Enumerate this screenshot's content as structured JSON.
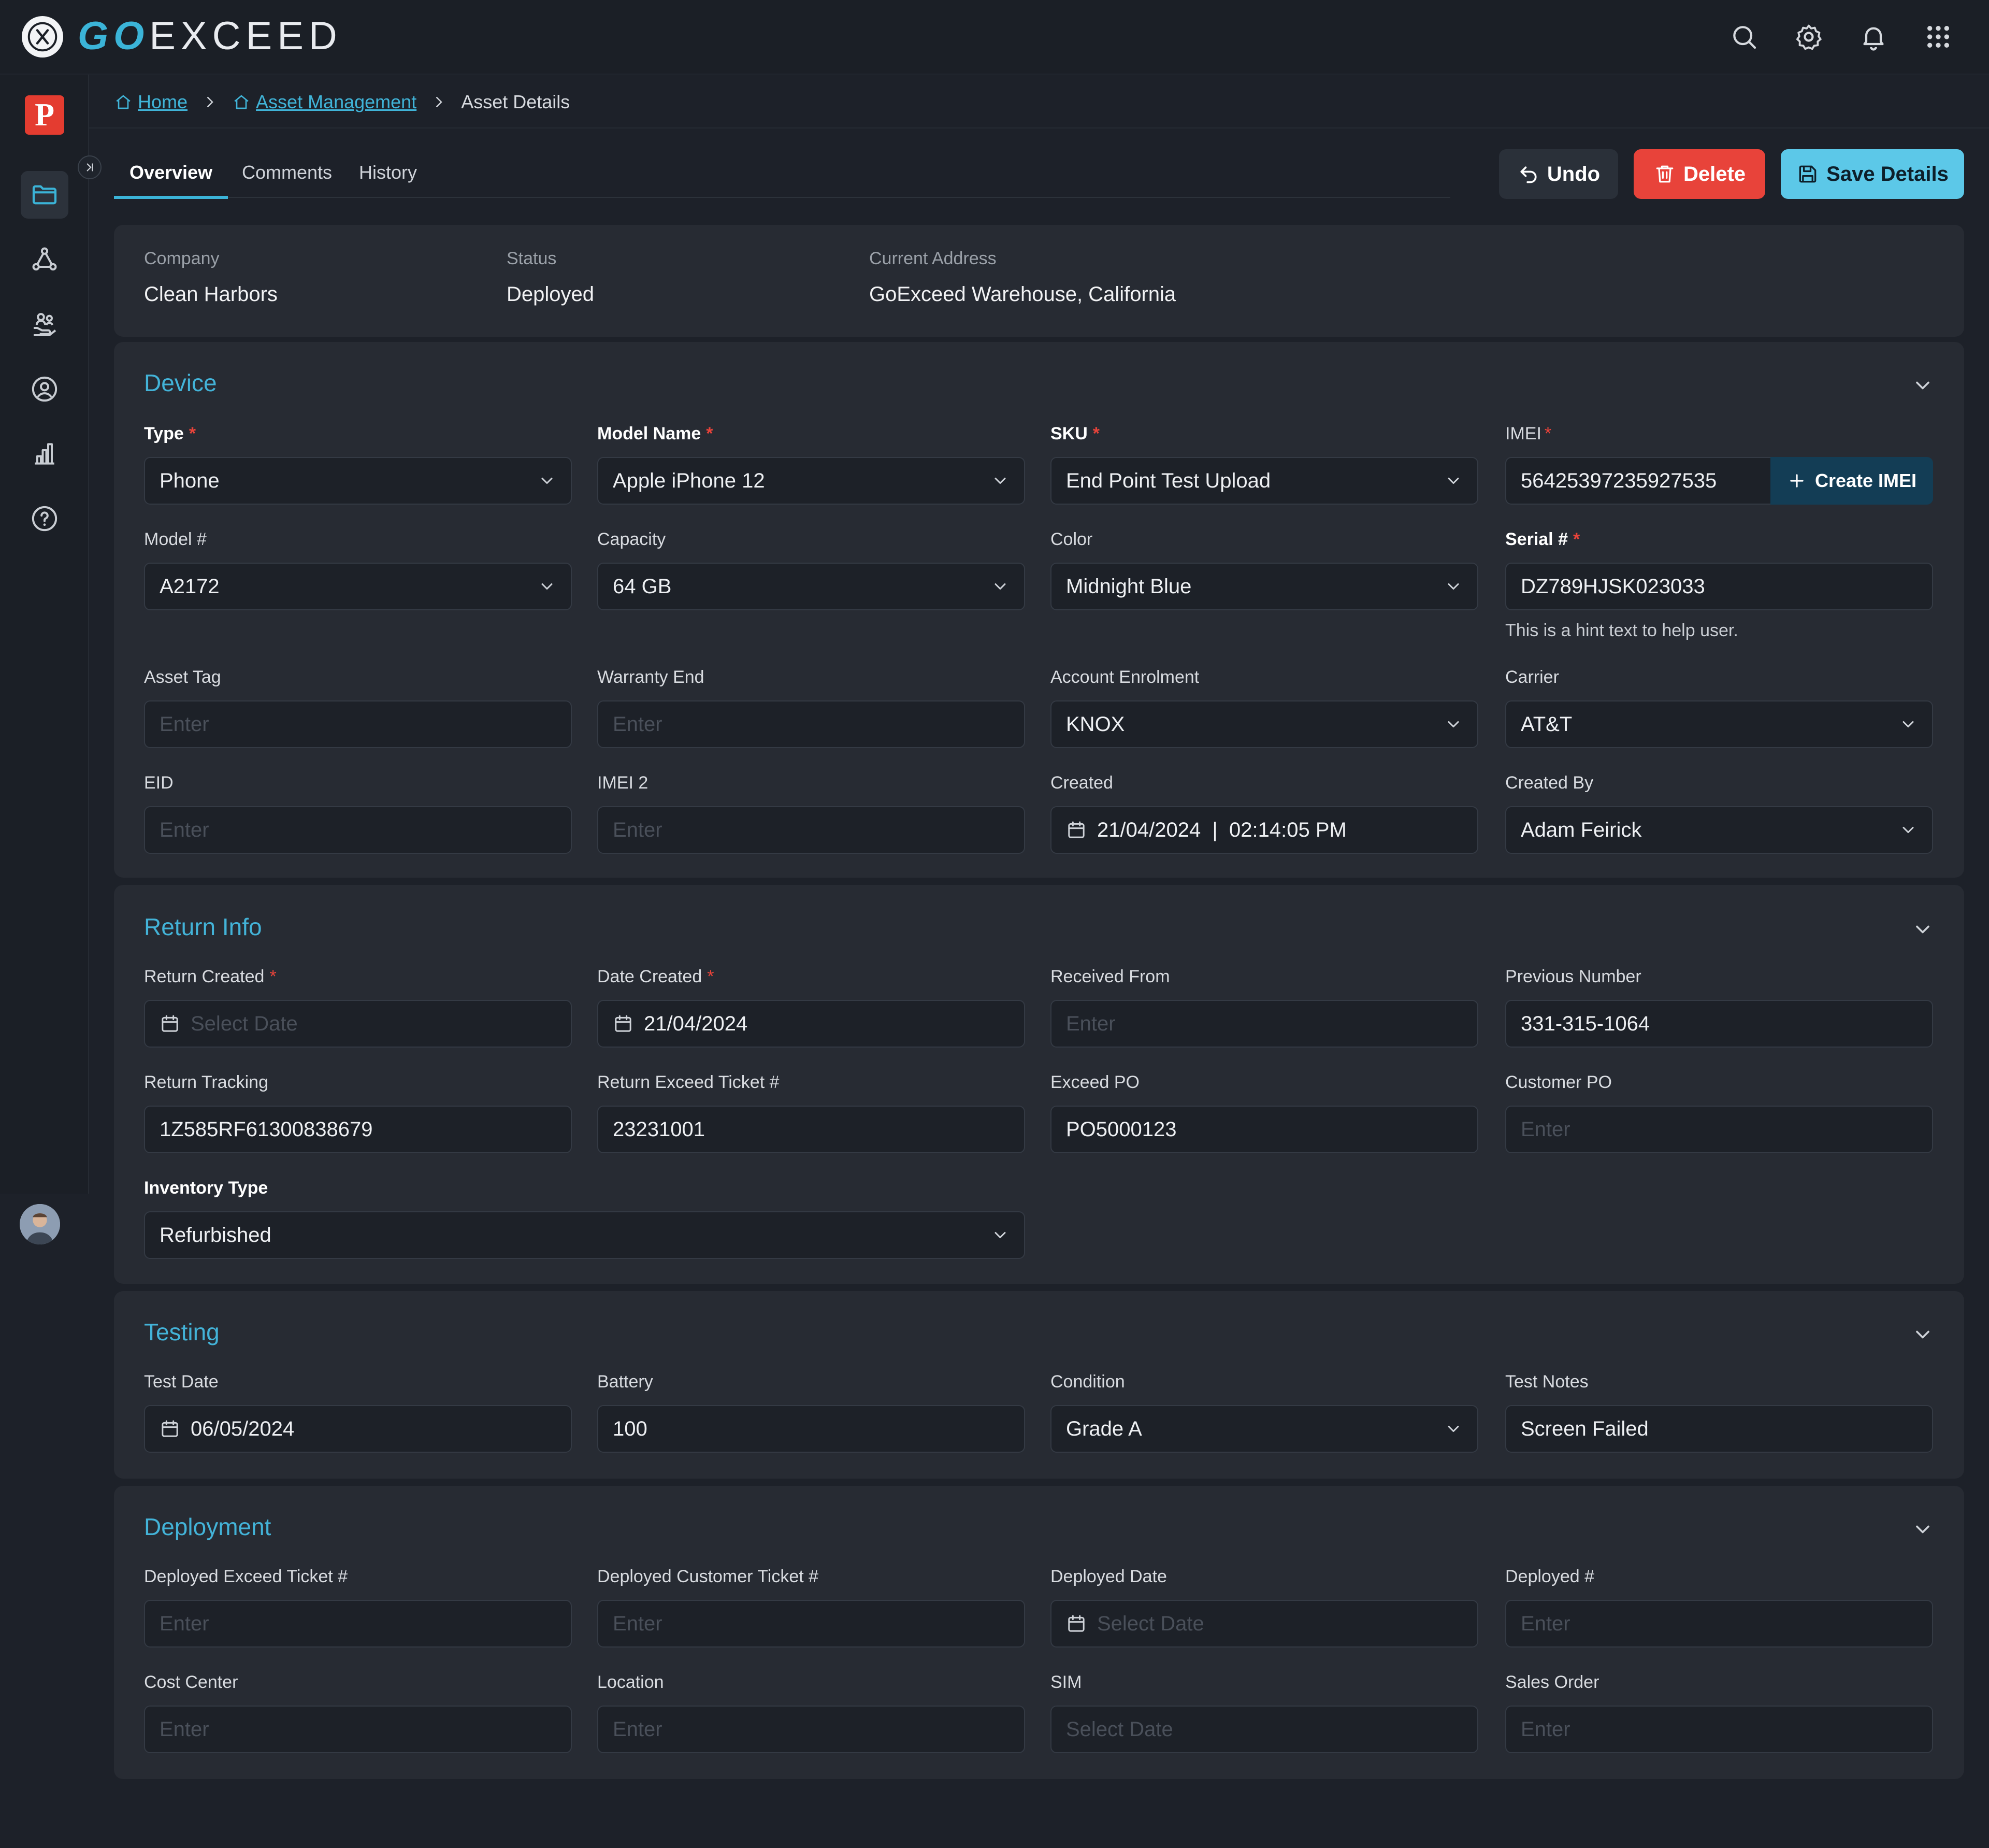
{
  "app": {
    "brand_go": "GO",
    "brand_rest": "EXCEED",
    "sidebar_logo_letter": "P"
  },
  "header": {
    "icons": [
      "search-icon",
      "gear-icon",
      "bell-icon",
      "apps-grid-icon"
    ]
  },
  "sidebar": {
    "icons": [
      "folder-icon",
      "workflow-icon",
      "hand-users-icon",
      "user-circle-icon",
      "bar-chart-icon",
      "help-icon"
    ]
  },
  "breadcrumb": {
    "home": "Home",
    "asset_management": "Asset Management",
    "current": "Asset Details"
  },
  "tabs": {
    "overview": "Overview",
    "comments": "Comments",
    "history": "History"
  },
  "actions": {
    "undo": "Undo",
    "delete": "Delete",
    "save": "Save Details"
  },
  "summary": {
    "company_label": "Company",
    "company_value": "Clean Harbors",
    "status_label": "Status",
    "status_value": "Deployed",
    "address_label": "Current Address",
    "address_value": "GoExceed Warehouse, California"
  },
  "device": {
    "title": "Device",
    "type": {
      "label": "Type",
      "value": "Phone"
    },
    "model_name": {
      "label": "Model Name",
      "value": "Apple iPhone 12"
    },
    "sku": {
      "label": "SKU",
      "value": "End Point Test Upload"
    },
    "imei": {
      "label": "IMEI",
      "value": "56425397235927535",
      "button": "Create IMEI"
    },
    "model_no": {
      "label": "Model #",
      "value": "A2172"
    },
    "capacity": {
      "label": "Capacity",
      "value": "64 GB"
    },
    "color": {
      "label": "Color",
      "value": "Midnight Blue"
    },
    "serial": {
      "label": "Serial #",
      "value": "DZ789HJSK023033",
      "hint": "This is a hint text to help user."
    },
    "asset_tag": {
      "label": "Asset Tag",
      "placeholder": "Enter"
    },
    "warranty_end": {
      "label": "Warranty End",
      "placeholder": "Enter"
    },
    "account_enrolment": {
      "label": "Account Enrolment",
      "value": "KNOX"
    },
    "carrier": {
      "label": "Carrier",
      "value": "AT&T"
    },
    "eid": {
      "label": "EID",
      "placeholder": "Enter"
    },
    "imei2": {
      "label": "IMEI 2",
      "placeholder": "Enter"
    },
    "created": {
      "label": "Created",
      "value": "21/04/2024  |  02:14:05 PM"
    },
    "created_by": {
      "label": "Created By",
      "value": "Adam Feirick"
    }
  },
  "return_info": {
    "title": "Return Info",
    "return_created": {
      "label": "Return Created",
      "placeholder": "Select Date"
    },
    "date_created": {
      "label": "Date Created",
      "value": "21/04/2024"
    },
    "received_from": {
      "label": "Received From",
      "placeholder": "Enter"
    },
    "previous_number": {
      "label": "Previous Number",
      "value": "331-315-1064"
    },
    "return_tracking": {
      "label": "Return Tracking",
      "value": "1Z585RF61300838679"
    },
    "return_exceed_ticket": {
      "label": "Return Exceed Ticket #",
      "value": "23231001"
    },
    "exceed_po": {
      "label": "Exceed PO",
      "value": "PO5000123"
    },
    "customer_po": {
      "label": "Customer PO",
      "placeholder": "Enter"
    },
    "inventory_type": {
      "label": "Inventory Type",
      "value": "Refurbished"
    }
  },
  "testing": {
    "title": "Testing",
    "test_date": {
      "label": "Test Date",
      "value": "06/05/2024"
    },
    "battery": {
      "label": "Battery",
      "value": "100"
    },
    "condition": {
      "label": "Condition",
      "value": "Grade A"
    },
    "test_notes": {
      "label": "Test Notes",
      "value": "Screen Failed"
    }
  },
  "deployment": {
    "title": "Deployment",
    "deployed_exceed_ticket": {
      "label": "Deployed Exceed Ticket #",
      "placeholder": "Enter"
    },
    "deployed_customer_ticket": {
      "label": "Deployed Customer Ticket #",
      "placeholder": "Enter"
    },
    "deployed_date": {
      "label": "Deployed Date",
      "placeholder": "Select Date"
    },
    "deployed_no": {
      "label": "Deployed #",
      "placeholder": "Enter"
    },
    "cost_center": {
      "label": "Cost Center",
      "placeholder": "Enter"
    },
    "location": {
      "label": "Location",
      "placeholder": "Enter"
    },
    "sim": {
      "label": "SIM",
      "placeholder": "Select Date"
    },
    "sales_order": {
      "label": "Sales Order",
      "placeholder": "Enter"
    }
  },
  "colors": {
    "accent": "#3bb4d8",
    "danger": "#e8433a",
    "save": "#5cc8e8",
    "background": "#1d2129",
    "panel": "#272b33"
  }
}
